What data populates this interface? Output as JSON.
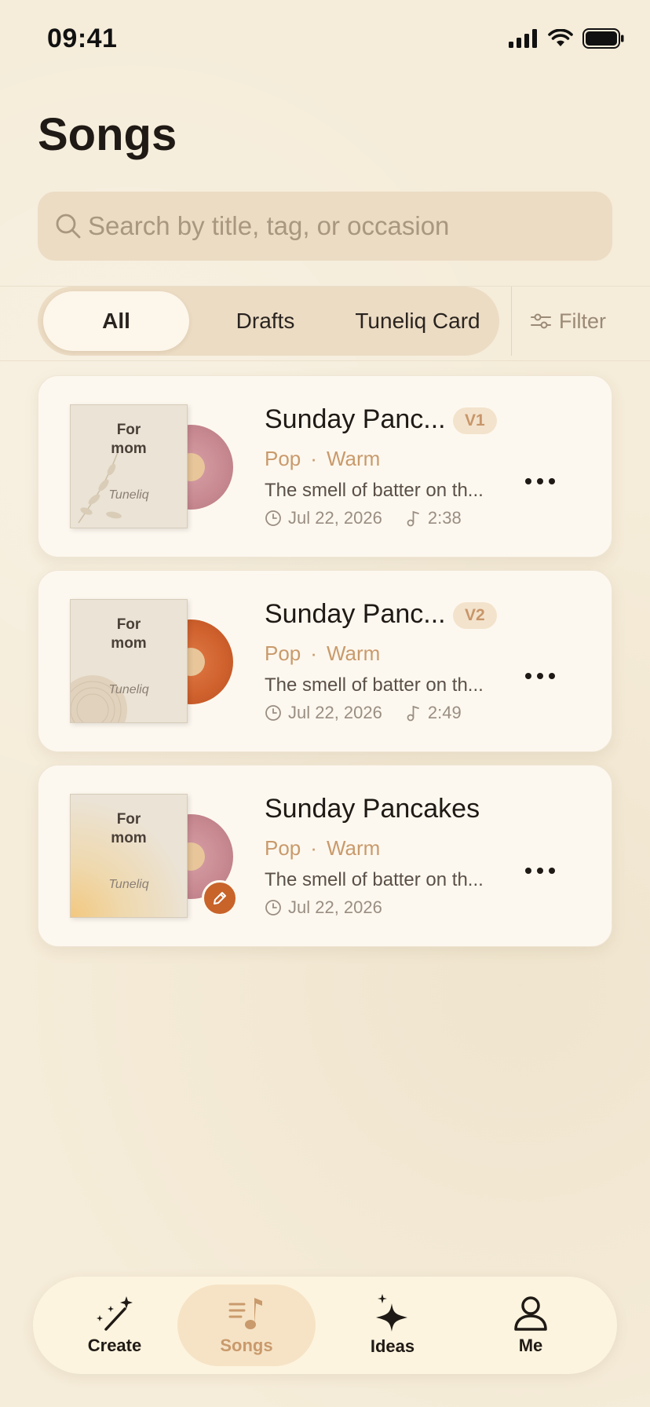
{
  "status": {
    "time": "09:41"
  },
  "page": {
    "title": "Songs"
  },
  "search": {
    "placeholder": "Search by title, tag, or occasion"
  },
  "segments": {
    "all": "All",
    "drafts": "Drafts",
    "card": "Tuneliq Card",
    "selected": "All"
  },
  "filter": {
    "label": "Filter"
  },
  "songs": [
    {
      "title": "Sunday Panc...",
      "version": "V1",
      "genre": "Pop",
      "mood": "Warm",
      "separator": "·",
      "description": "The smell of batter on th...",
      "date": "Jul 22, 2026",
      "duration": "2:38",
      "cover_text": "For mom",
      "cover_brand": "Tuneliq",
      "vinyl_color": "#c98a92"
    },
    {
      "title": "Sunday Panc...",
      "version": "V2",
      "genre": "Pop",
      "mood": "Warm",
      "separator": "·",
      "description": "The smell of batter on th...",
      "date": "Jul 22, 2026",
      "duration": "2:49",
      "cover_text": "For mom",
      "cover_brand": "Tuneliq",
      "vinyl_color": "#d0622e"
    },
    {
      "title": "Sunday Pancakes",
      "genre": "Pop",
      "mood": "Warm",
      "separator": "·",
      "description": "The smell of batter on th...",
      "date": "Jul 22, 2026",
      "cover_text": "For mom",
      "cover_brand": "Tuneliq",
      "vinyl_color": "#c98a92",
      "draft": true
    }
  ],
  "tabbar": {
    "create": "Create",
    "songs": "Songs",
    "ideas": "Ideas",
    "me": "Me",
    "active": "Songs"
  },
  "colors": {
    "accent": "#c99a6c",
    "background": "#f5ecd9",
    "card": "#fdf8ef",
    "edit_badge": "#c8632a"
  }
}
